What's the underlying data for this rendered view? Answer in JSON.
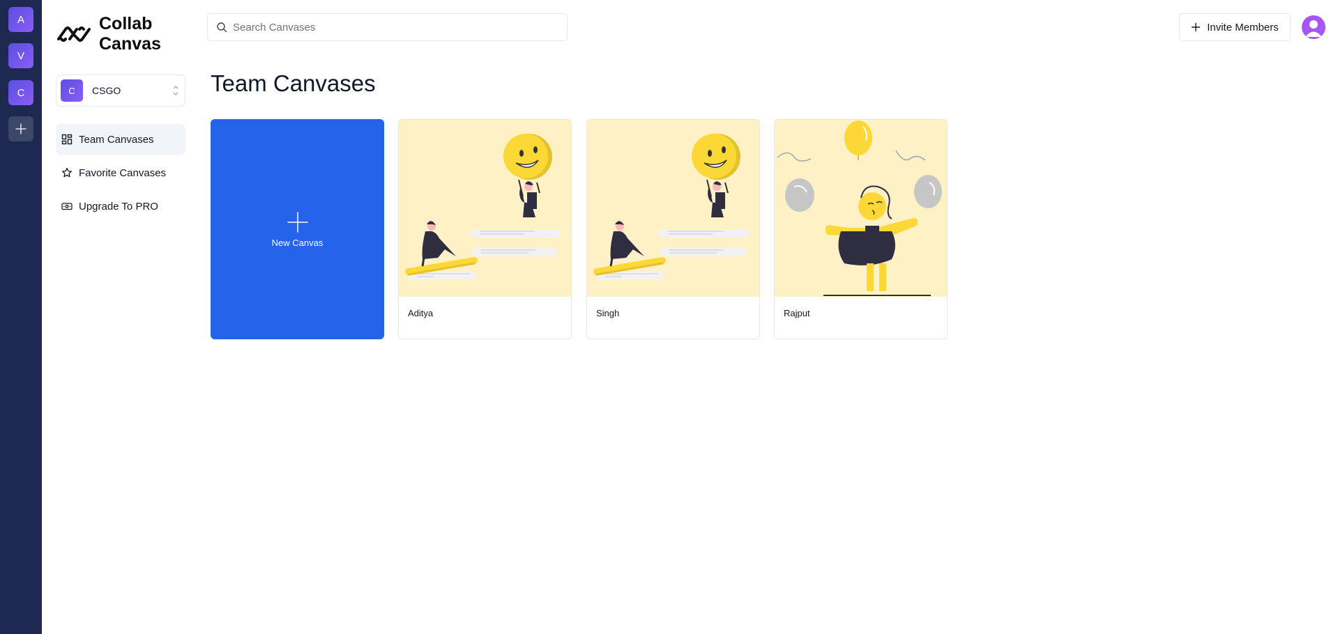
{
  "rail": {
    "orgs": [
      {
        "initial": "A"
      },
      {
        "initial": "V"
      },
      {
        "initial": "C"
      }
    ]
  },
  "sidebar": {
    "logo_text": "Collab Canvas",
    "logo_line1": "Collab",
    "logo_line2": "Canvas",
    "org": {
      "initial": "C",
      "name": "CSGO"
    },
    "nav": [
      {
        "label": "Team Canvases",
        "icon": "dashboard-icon",
        "active": true
      },
      {
        "label": "Favorite Canvases",
        "icon": "star-icon",
        "active": false
      },
      {
        "label": "Upgrade To PRO",
        "icon": "banknote-icon",
        "active": false
      }
    ]
  },
  "header": {
    "search_placeholder": "Search Canvases",
    "invite_label": "Invite Members"
  },
  "main": {
    "title": "Team Canvases",
    "new_canvas_label": "New Canvas",
    "canvases": [
      {
        "name": "Aditya",
        "illustration": "smiley-balloon"
      },
      {
        "name": "Singh",
        "illustration": "smiley-balloon"
      },
      {
        "name": "Rajput",
        "illustration": "celebration-balloons"
      }
    ]
  },
  "colors": {
    "rail_bg": "#1e2952",
    "accent_blue": "#2563eb",
    "purple": "#8b5cf6",
    "thumb_bg": "#fef1c6",
    "yellow": "#fcd836"
  }
}
